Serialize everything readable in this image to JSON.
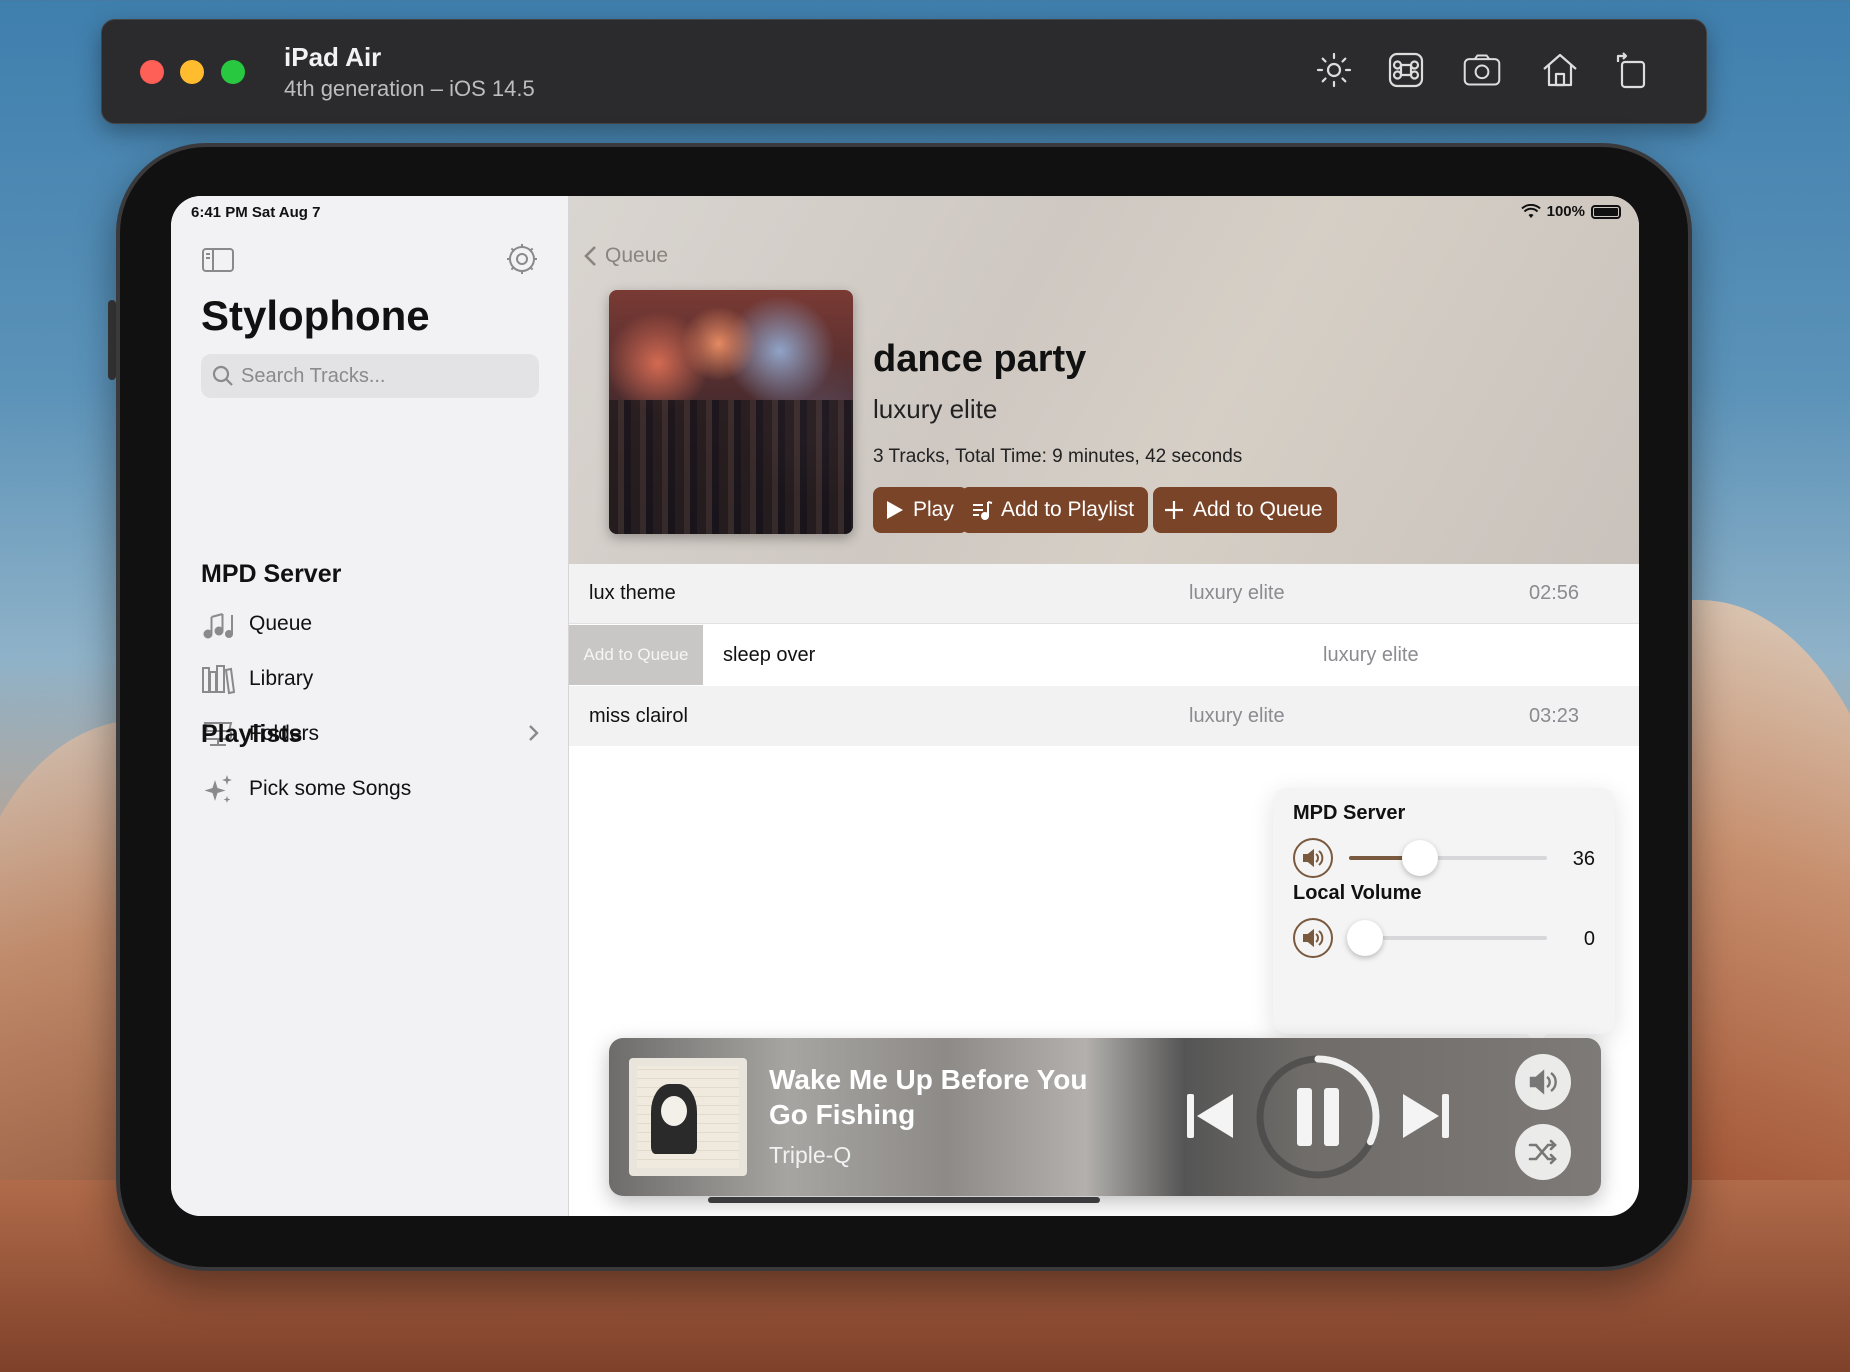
{
  "simulator": {
    "device_name": "iPad Air",
    "device_detail": "4th generation – iOS 14.5",
    "toolbar_icons": [
      "brightness-icon",
      "command-icon",
      "screenshot-icon",
      "home-icon",
      "rotate-icon"
    ]
  },
  "status_bar": {
    "time": "6:41 PM  Sat Aug 7",
    "battery": "100%"
  },
  "sidebar": {
    "app_title": "Stylophone",
    "search_placeholder": "Search Tracks...",
    "section_server": "MPD Server",
    "items": [
      {
        "label": "Queue",
        "icon": "music-notes-icon"
      },
      {
        "label": "Library",
        "icon": "books-icon"
      },
      {
        "label": "Folders",
        "icon": "server-folders-icon"
      },
      {
        "label": "Pick some Songs",
        "icon": "sparkles-icon"
      }
    ],
    "section_playlists": "Playlists"
  },
  "album": {
    "back_label": "Queue",
    "title": "dance party",
    "artist": "luxury elite",
    "meta": "3 Tracks, Total Time: 9 minutes, 42 seconds",
    "actions": {
      "play": "Play",
      "add_playlist": "Add to Playlist",
      "add_queue": "Add to Queue"
    }
  },
  "tracks": [
    {
      "name": "lux theme",
      "artist": "luxury elite",
      "duration": "02:56"
    },
    {
      "name": "sleep over",
      "artist": "luxury elite",
      "duration": "",
      "swipe_action": "Add to Queue"
    },
    {
      "name": "miss clairol",
      "artist": "luxury elite",
      "duration": "03:23"
    }
  ],
  "volume_popover": {
    "server_label": "MPD Server",
    "server_value": "36",
    "server_level": 0.36,
    "local_label": "Local Volume",
    "local_value": "0",
    "local_level": 0
  },
  "now_playing": {
    "title": "Wake Me Up Before You Go Fishing",
    "artist": "Triple-Q",
    "progress": 0.32
  },
  "colors": {
    "accent": "#7a4428",
    "slider_fill": "#7a5a3e"
  }
}
